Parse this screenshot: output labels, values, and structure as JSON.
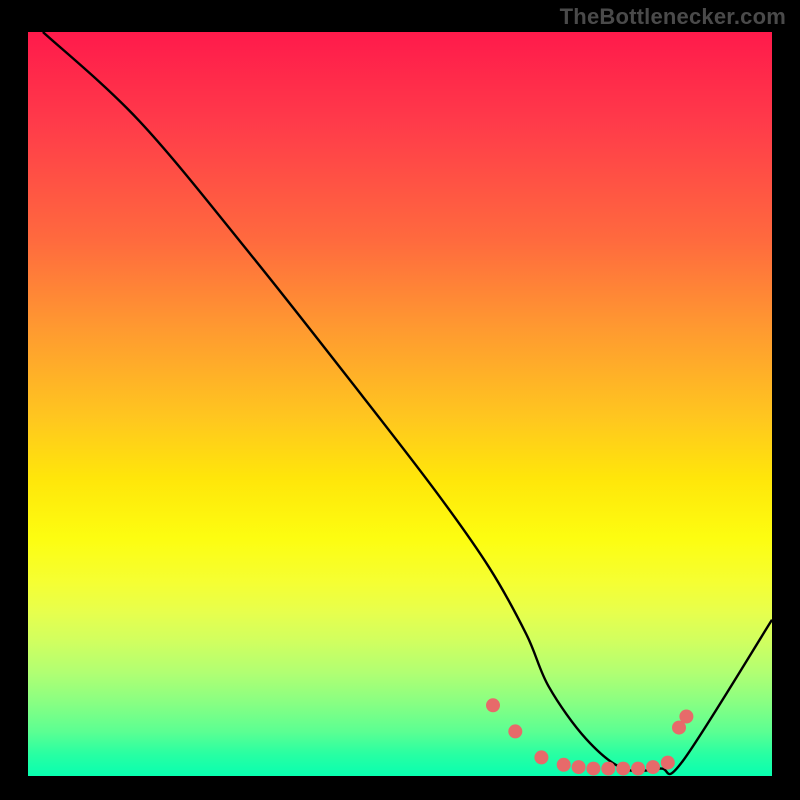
{
  "attribution": "TheBottlenecker.com",
  "chart_data": {
    "type": "line",
    "title": "",
    "xlabel": "",
    "ylabel": "",
    "xlim": [
      0,
      100
    ],
    "ylim": [
      0,
      100
    ],
    "series": [
      {
        "name": "bottleneck-curve",
        "x": [
          2,
          15,
          30,
          45,
          55,
          62,
          67,
          70,
          75,
          80,
          85,
          88,
          100
        ],
        "values": [
          100,
          88,
          70,
          51,
          38,
          28,
          19,
          12,
          5,
          1,
          1,
          2,
          21
        ]
      }
    ],
    "markers": {
      "name": "highlight-range",
      "color": "#e76a6a",
      "points": [
        {
          "x": 62.5,
          "y": 9.5
        },
        {
          "x": 65.5,
          "y": 6.0
        },
        {
          "x": 69.0,
          "y": 2.5
        },
        {
          "x": 72.0,
          "y": 1.5
        },
        {
          "x": 74.0,
          "y": 1.2
        },
        {
          "x": 76.0,
          "y": 1.0
        },
        {
          "x": 78.0,
          "y": 1.0
        },
        {
          "x": 80.0,
          "y": 1.0
        },
        {
          "x": 82.0,
          "y": 1.0
        },
        {
          "x": 84.0,
          "y": 1.2
        },
        {
          "x": 86.0,
          "y": 1.8
        },
        {
          "x": 87.5,
          "y": 6.5
        },
        {
          "x": 88.5,
          "y": 8.0
        }
      ]
    },
    "gradient_stops": [
      {
        "pos": 0,
        "color": "#ff1a4b"
      },
      {
        "pos": 12,
        "color": "#ff3a4a"
      },
      {
        "pos": 28,
        "color": "#ff6a3e"
      },
      {
        "pos": 40,
        "color": "#ff9a30"
      },
      {
        "pos": 52,
        "color": "#ffc71f"
      },
      {
        "pos": 60,
        "color": "#ffe60a"
      },
      {
        "pos": 68,
        "color": "#fdfd10"
      },
      {
        "pos": 74,
        "color": "#f5ff33"
      },
      {
        "pos": 78,
        "color": "#e7ff4d"
      },
      {
        "pos": 82,
        "color": "#d0ff60"
      },
      {
        "pos": 86,
        "color": "#b2ff72"
      },
      {
        "pos": 90,
        "color": "#8aff82"
      },
      {
        "pos": 94,
        "color": "#5cff92"
      },
      {
        "pos": 97,
        "color": "#29ffa2"
      },
      {
        "pos": 100,
        "color": "#08ffb0"
      }
    ]
  },
  "colors": {
    "marker": "#e76a6a",
    "curve": "#000000",
    "frame_bg": "#000000",
    "attribution_text": "#4a4a4a"
  }
}
